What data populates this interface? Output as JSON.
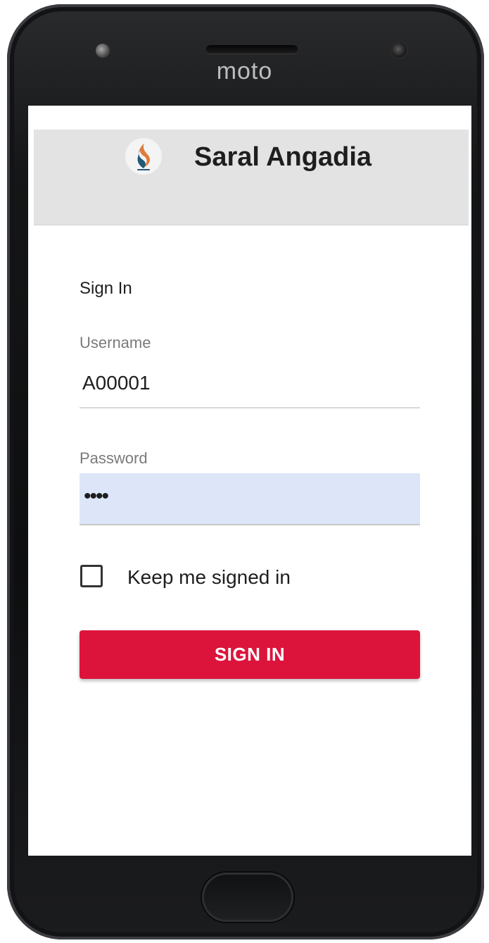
{
  "device": {
    "brand": "moto"
  },
  "app": {
    "title": "Saral Angadia"
  },
  "signin": {
    "heading": "Sign In",
    "username_label": "Username",
    "username_value": "A00001",
    "password_label": "Password",
    "password_value": "••••",
    "keep_signed_in_label": "Keep me signed in",
    "keep_signed_in_checked": false,
    "button_label": "SIGN IN"
  },
  "colors": {
    "accent": "#dc143c",
    "appbar": "#e3e3e3",
    "password_autofill_bg": "#dce6f8"
  }
}
